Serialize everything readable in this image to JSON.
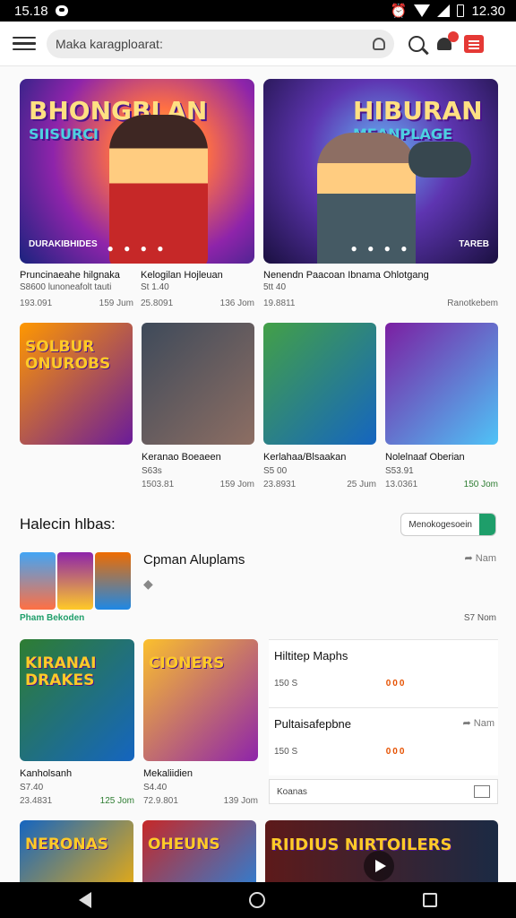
{
  "status": {
    "time": "15.18",
    "clock": "12.30"
  },
  "search": {
    "text": "Maka karagploarat:"
  },
  "hero": [
    {
      "art_title": "BHONGBLAN",
      "art_title2": "SIISURCI",
      "tag": "DURAKIBHIDES",
      "lines": [
        {
          "title": "Pruncinaeahe hilgnaka",
          "sub": "S8600 lunoneafolt tauti",
          "left": "193.091",
          "right": "159 Jum"
        },
        {
          "title": "Kelogilan Hojleuan",
          "sub": "St 1.40",
          "left": "25.8091",
          "right": "136 Jom"
        }
      ]
    },
    {
      "art_title": "HIBURAN",
      "art_title2": "MEANPLAGE",
      "tag": "TAREB",
      "lines": [
        {
          "title": "Nenendn Paacoan Ibnama Ohlotgang",
          "sub": "5tt 40",
          "left": "19.8811",
          "right": "Ranotkebem"
        }
      ]
    }
  ],
  "tiles": [
    {
      "art": "SOLBUR ONUROBS",
      "name": "",
      "sub": "",
      "left": "",
      "right": "",
      "colors": [
        "#ff9800",
        "#6a1b9a"
      ]
    },
    {
      "art": "",
      "name": "Keranao Boeaeen",
      "sub": "S63s",
      "left": "1503.81",
      "right": "159 Jom",
      "colors": [
        "#3e4a5a",
        "#8d6e63"
      ]
    },
    {
      "art": "",
      "name": "Kerlahaa/Blsaakan",
      "sub": "S5 00",
      "left": "23.8931",
      "right": "25 Jum",
      "colors": [
        "#43a047",
        "#1565c0"
      ]
    },
    {
      "art": "",
      "name": "Nolelnaaf Oberian",
      "sub": "S53.91",
      "left": "13.0361",
      "right": "150 Jom",
      "right_green": true,
      "colors": [
        "#7b1fa2",
        "#4fc3f7"
      ]
    }
  ],
  "section": {
    "title": "Halecin hlbas:",
    "button": "Menokogesoein"
  },
  "list_item": {
    "title": "Cpman Aluplams",
    "share": "Nam",
    "foot_left": "Pham Bekoden",
    "foot_right": "S7 Nom"
  },
  "cards": [
    {
      "art": "KIRANAI DRAKES",
      "name": "Kanholsanh",
      "sub": "S7.40",
      "left": "23.4831",
      "right": "125 Jom",
      "right_green": true,
      "colors": [
        "#2e7d32",
        "#1565c0"
      ]
    },
    {
      "art": "CIONERS",
      "name": "Mekaliidien",
      "sub": "S4.40",
      "left": "72.9.801",
      "right": "139 Jom",
      "colors": [
        "#fbc02d",
        "#8e24aa"
      ]
    }
  ],
  "side": [
    {
      "title": "Hiltitep Maphs",
      "left": "150 S",
      "right": "000"
    },
    {
      "title": "Pultaisafepbne",
      "left": "150 S",
      "right": "000",
      "share": "Nam"
    }
  ],
  "side_input": {
    "text": "Koanas"
  },
  "bottom": [
    {
      "art": "NERONAS",
      "colors": [
        "#1565c0",
        "#ffb300"
      ]
    },
    {
      "art": "OHEUNS",
      "colors": [
        "#c62828",
        "#1e88e5"
      ]
    },
    {
      "art": "RIIDIUS   NIRTOILERS"
    }
  ]
}
